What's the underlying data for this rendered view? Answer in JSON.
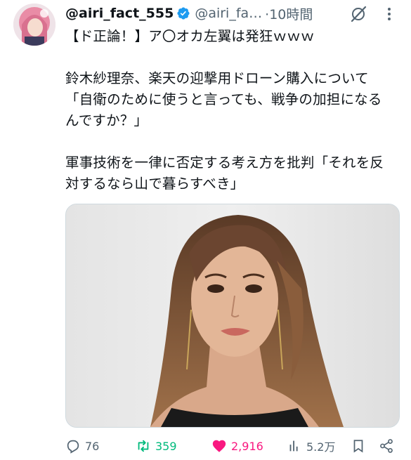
{
  "post": {
    "display_name": "@airi_fact_555",
    "handle": "@airi_fa…",
    "time": "·10時間",
    "text": "【ド正論！】ア〇オカ左翼は発狂ｗｗｗ\n\n鈴木紗理奈、楽天の迎撃用ドローン購入について「自衛のために使うと言っても、戦争の加担になるんですか？」\n\n軍事技術を一律に否定する考え方を批判「それを反対するなら山で暮らすべき」"
  },
  "actions": {
    "replies": "76",
    "reposts": "359",
    "likes": "2,916",
    "views": "5.2万"
  },
  "colors": {
    "verified": "#1d9bf0",
    "repost": "#00ba7c",
    "like": "#f91880",
    "secondary": "#536471"
  },
  "icons": {
    "verified": "verified-badge-icon",
    "grok": "grok-icon",
    "more": "more-icon",
    "reply": "reply-icon",
    "repost": "repost-icon",
    "like": "heart-icon",
    "views": "views-icon",
    "bookmark": "bookmark-icon",
    "share": "share-icon"
  }
}
